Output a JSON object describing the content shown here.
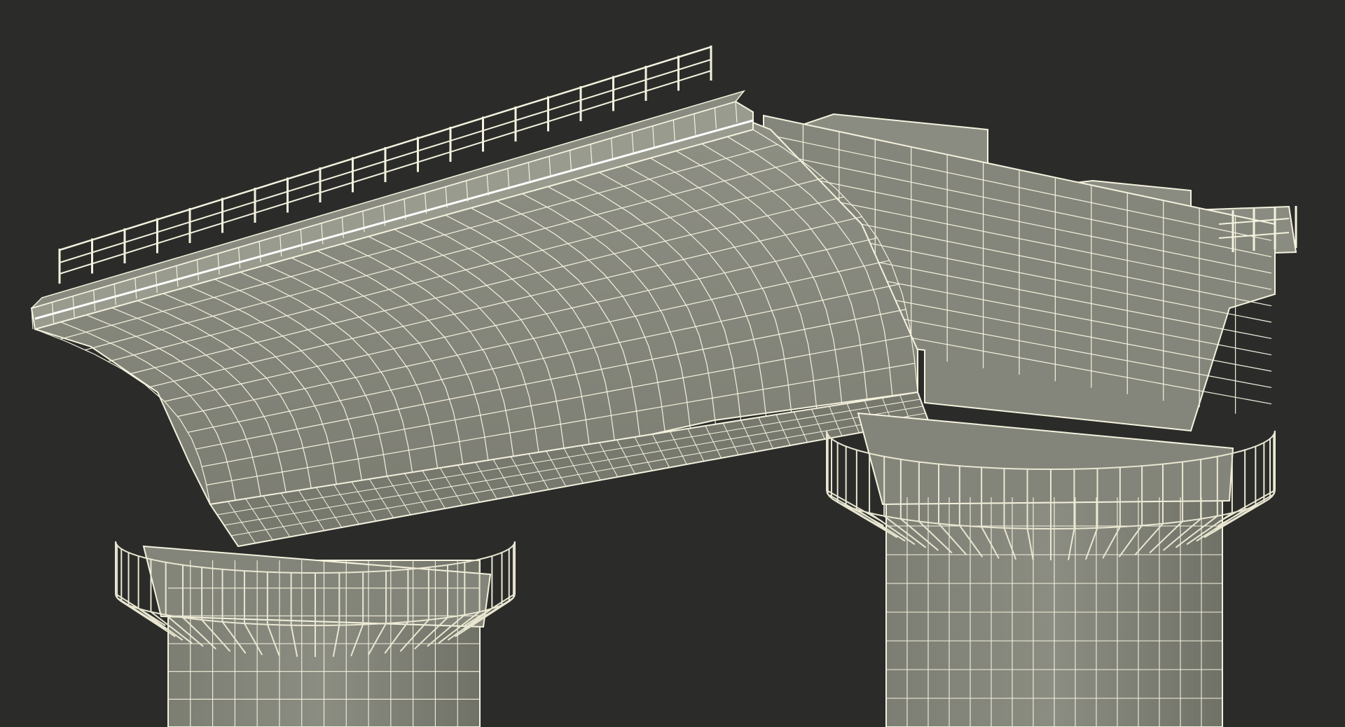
{
  "scene": {
    "subject": "bridge-deck-wireframe-render",
    "colors": {
      "background": "#2b2c2a",
      "surface": "#8a8b7f",
      "surface_light": "#9c9d91",
      "surface_dark": "#6f7066",
      "wire": "#f4f2de",
      "wire_dim": "#d9d7c2"
    }
  }
}
